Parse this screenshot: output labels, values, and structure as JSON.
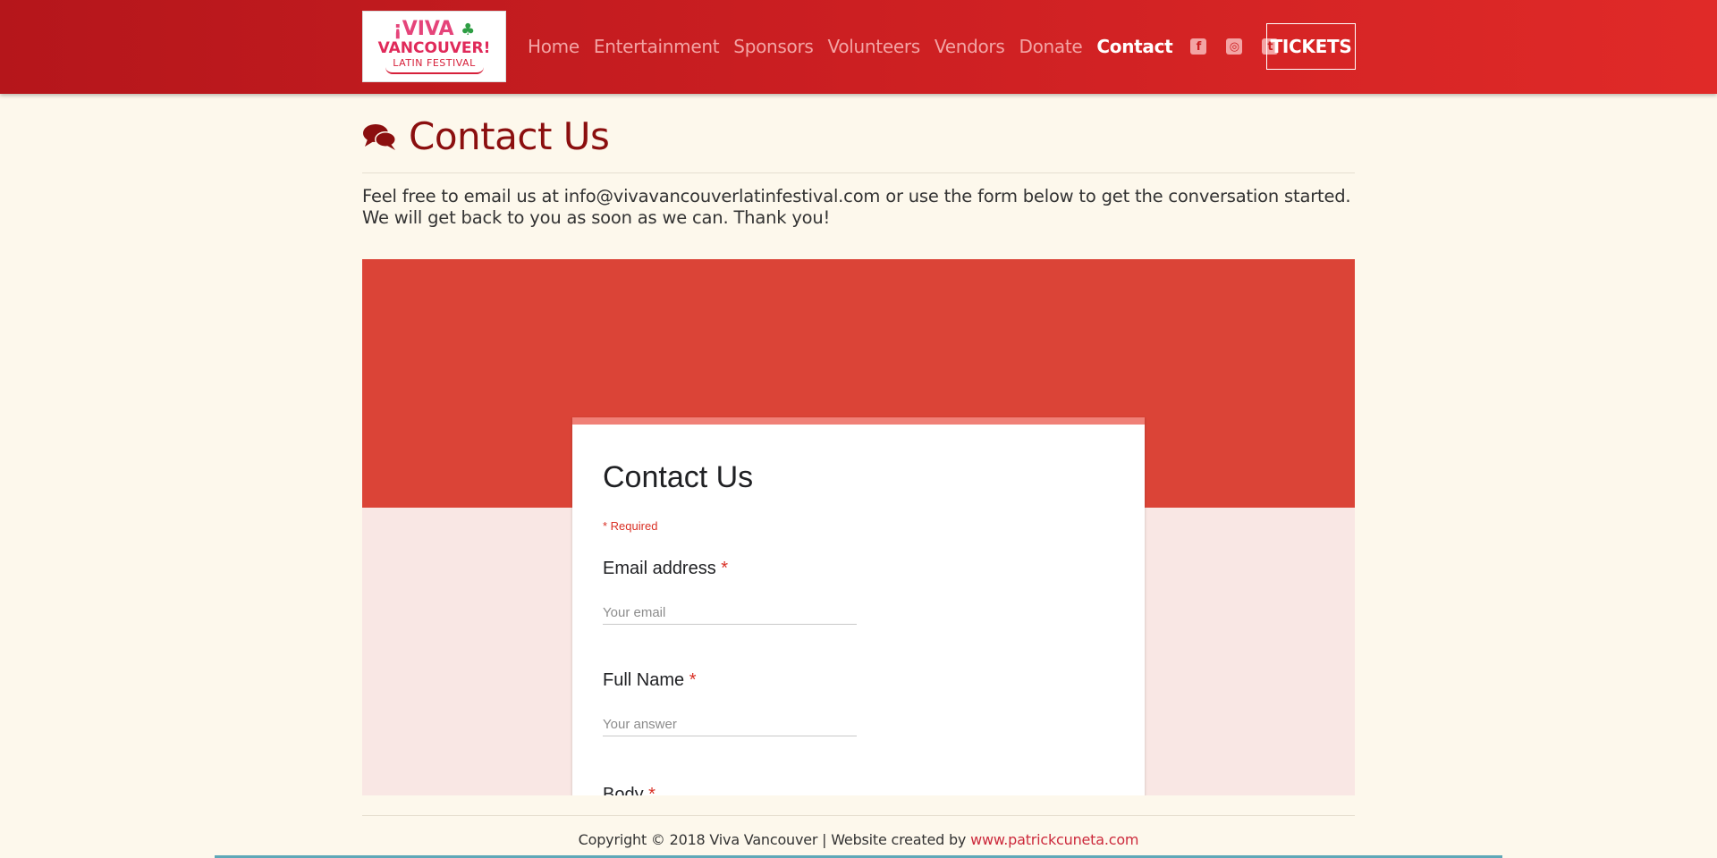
{
  "header": {
    "logo": {
      "line1": "¡VIVA",
      "leaf": "♣",
      "line2": "VANCOUVER!",
      "line3": "LATIN FESTIVAL"
    },
    "nav": [
      "Home",
      "Entertainment",
      "Sponsors",
      "Volunteers",
      "Vendors",
      "Donate",
      "Contact"
    ],
    "active_nav": "Contact",
    "social_icons": [
      "facebook-icon",
      "instagram-icon",
      "twitter-icon"
    ],
    "social_glyphs": [
      "f",
      "◎",
      "t"
    ],
    "tickets_label": "TICKETS"
  },
  "page": {
    "title": "Contact Us",
    "intro": "Feel free to email us at info@vivavancouverlatinfestival.com or use the form below to get the conversation started. We will get back to you as soon as we can. Thank you!"
  },
  "form": {
    "title": "Contact Us",
    "required_note": "* Required",
    "questions": [
      {
        "label": "Email address",
        "required_mark": "*",
        "placeholder": "Your email"
      },
      {
        "label": "Full Name",
        "required_mark": "*",
        "placeholder": "Your answer"
      },
      {
        "label": "Body",
        "required_mark": "*"
      }
    ]
  },
  "footer": {
    "copyright": "Copyright © 2018 Viva Vancouver | Website created by",
    "link_text": "www.patrickcuneta.com"
  },
  "colors": {
    "header_red": "#cc1f22",
    "title_maroon": "#8b0f0f",
    "form_header": "#db4437",
    "form_bg": "#f9e7e4",
    "page_bg": "#fdf8ec"
  }
}
